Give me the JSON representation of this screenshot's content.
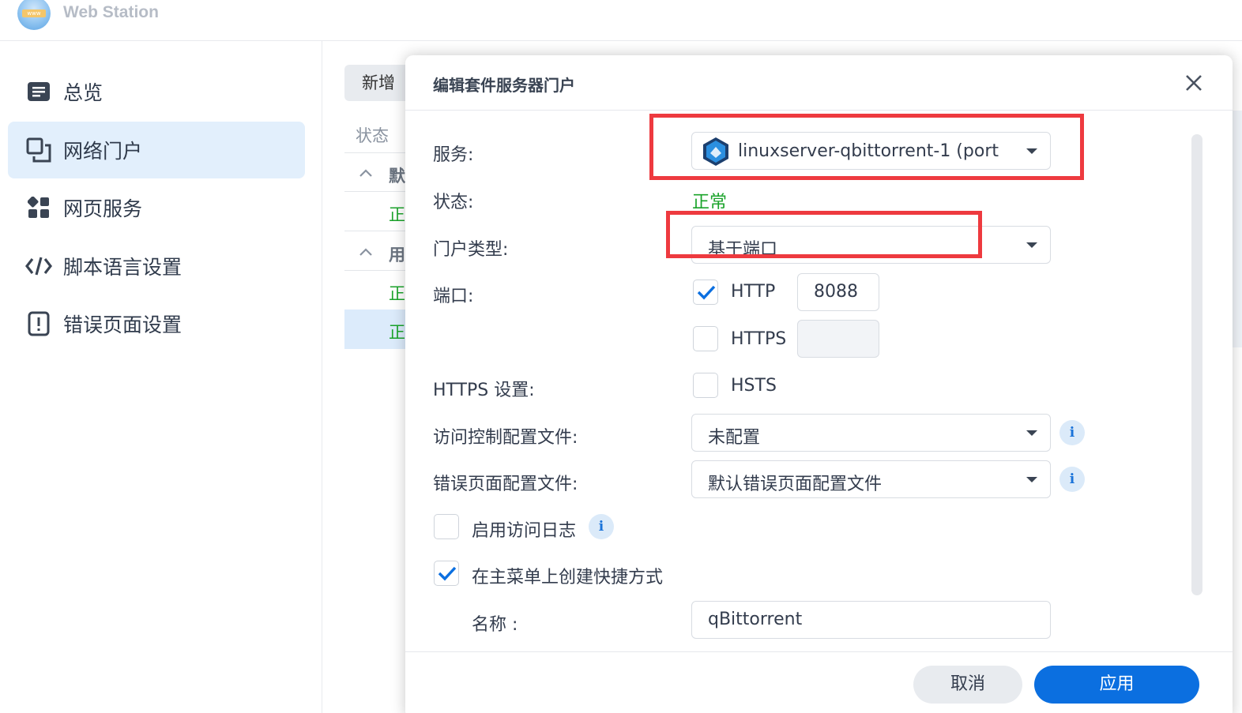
{
  "app": {
    "title": "Web Station",
    "logo_text": "www"
  },
  "sidebar": {
    "items": [
      {
        "label": "总览",
        "icon": "overview-icon"
      },
      {
        "label": "网络门户",
        "icon": "portal-icon",
        "active": true
      },
      {
        "label": "网页服务",
        "icon": "web-service-icon"
      },
      {
        "label": "脚本语言设置",
        "icon": "code-icon"
      },
      {
        "label": "错误页面设置",
        "icon": "error-page-icon"
      }
    ]
  },
  "background_list": {
    "add_button": "新增",
    "column_status": "状态",
    "groups": [
      {
        "label": "默"
      },
      {
        "label": "用"
      }
    ],
    "row_status": [
      "正",
      "正",
      "正"
    ]
  },
  "dialog": {
    "title": "编辑套件服务器门户",
    "service_label": "服务:",
    "service_value": "linuxserver-qbittorrent-1 (port",
    "status_label": "状态:",
    "status_value": "正常",
    "portal_type_label": "门户类型:",
    "portal_type_value": "基于端口",
    "port_label": "端口:",
    "http_label": "HTTP",
    "http_checked": true,
    "http_port": "8088",
    "https_label": "HTTPS",
    "https_checked": false,
    "https_port": "",
    "https_settings_label": "HTTPS 设置:",
    "hsts_label": "HSTS",
    "hsts_checked": false,
    "access_control_label": "访问控制配置文件:",
    "access_control_value": "未配置",
    "error_page_label": "错误页面配置文件:",
    "error_page_value": "默认错误页面配置文件",
    "access_log_label": "启用访问日志",
    "access_log_checked": false,
    "shortcut_label": "在主菜单上创建快捷方式",
    "shortcut_checked": true,
    "name_label": "名称 :",
    "name_value": "qBittorrent",
    "cancel_button": "取消",
    "apply_button": "应用",
    "info_glyph": "i"
  },
  "colors": {
    "accent": "#0b6fe0",
    "status_ok": "#1aa32a",
    "highlight_red": "#ee3a3f",
    "sidebar_active": "#e2effc"
  }
}
